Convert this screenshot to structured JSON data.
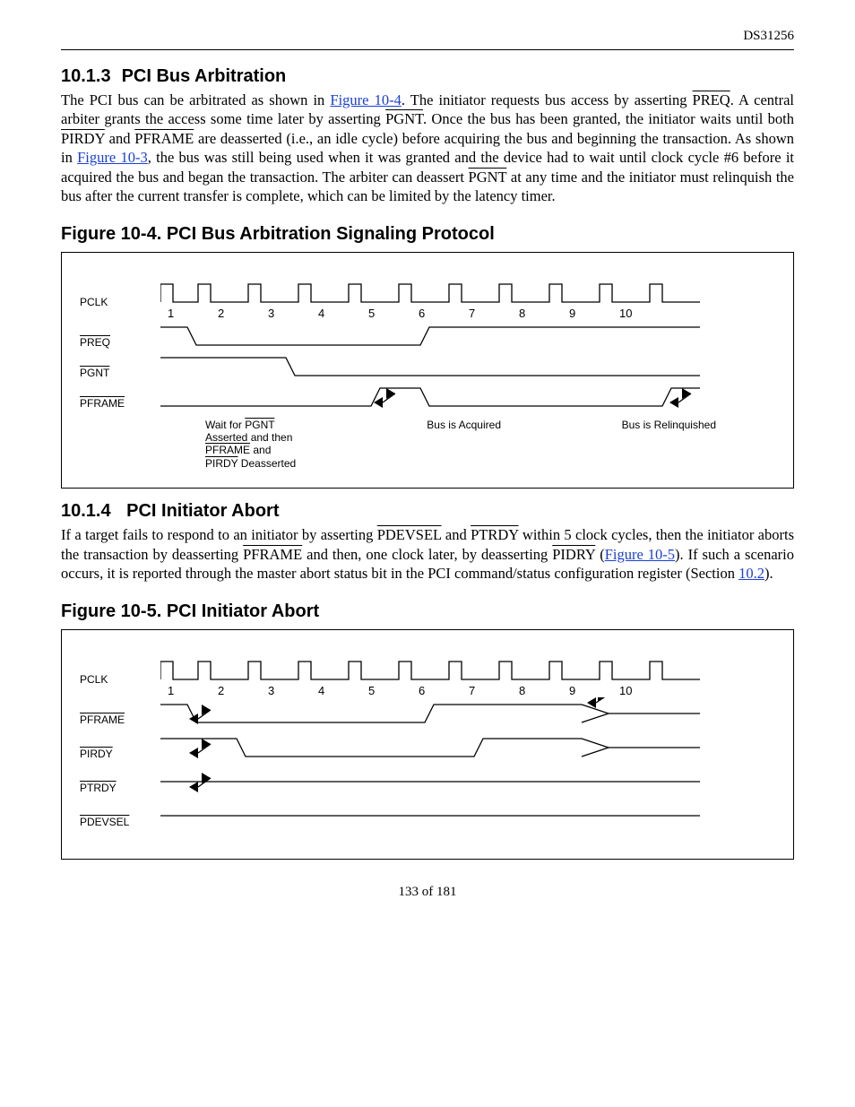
{
  "header": {
    "doc_id": "DS31256"
  },
  "section1": {
    "num": "10.1.3",
    "title": "PCI Bus Arbitration",
    "p_a": "The PCI bus can be arbitrated as shown in ",
    "link1": "Figure 10-4",
    "p_b": ". The initiator requests bus access by asserting ",
    "sig1": "PREQ",
    "p_c": ". A central arbiter grants the access some time later by asserting ",
    "sig2": "PGNT",
    "p_d": ". Once the bus has been granted, the initiator waits until both ",
    "sig3": "PIRDY",
    "p_e": " and ",
    "sig4": "PFRAME",
    "p_f": " are deasserted (i.e., an idle cycle) before acquiring the bus and beginning the transaction. As shown in ",
    "link2": "Figure 10-3",
    "p_g": ", the bus was still being used when it was granted and the device had to wait until clock cycle #6 before it acquired the bus and began the transaction. The arbiter can deassert ",
    "sig5": "PGNT",
    "p_h": " at any time and the initiator must relinquish the bus after the current transfer is complete, which can be limited by the latency timer."
  },
  "figure1": {
    "caption": "Figure 10-4. PCI Bus Arbitration Signaling Protocol",
    "ticks": [
      "1",
      "2",
      "3",
      "4",
      "5",
      "6",
      "7",
      "8",
      "9",
      "10"
    ],
    "signals": {
      "s1": "PCLK",
      "s2": "PREQ",
      "s3": "PGNT",
      "s4": "PFRAME"
    },
    "annot1_a": "Wait for ",
    "annot1_sig1": "PGNT",
    "annot1_b": " Asserted and then ",
    "annot1_sig2": "PFRAME",
    "annot1_c": " and ",
    "annot1_sig3": "PIRDY",
    "annot1_d": " Deasserted",
    "annot2": "Bus is Acquired",
    "annot3": "Bus is Relinquished"
  },
  "section2": {
    "num": "10.1.4",
    "title": "PCI Initiator Abort",
    "p_a": "If a target fails to respond to an initiator by asserting ",
    "sig1": "PDEVSEL",
    "p_b": " and ",
    "sig2": "PTRDY",
    "p_c": " within 5 clock cycles, then the initiator aborts the transaction by deasserting ",
    "sig3": "PFRAME",
    "p_d": " and then, one clock later, by deasserting ",
    "sig4": "PIDRY",
    "p_e": " (",
    "link1": "Figure 10-5",
    "p_f": "). If such a scenario occurs, it is reported through the master abort status bit in the PCI command/status configuration register (Section ",
    "link2": "10.2",
    "p_g": ")."
  },
  "figure2": {
    "caption": "Figure 10-5. PCI Initiator Abort",
    "ticks": [
      "1",
      "2",
      "3",
      "4",
      "5",
      "6",
      "7",
      "8",
      "9",
      "10"
    ],
    "signals": {
      "s1": "PCLK",
      "s2": "PFRAME",
      "s3": "PIRDY",
      "s4": "PTRDY",
      "s5": "PDEVSEL"
    }
  },
  "footer": {
    "page": "133 of 181"
  },
  "chart_data": [
    {
      "type": "timing-diagram",
      "title": "PCI Bus Arbitration Signaling Protocol",
      "clock_cycles": 10,
      "signals": [
        {
          "name": "PCLK",
          "type": "clock",
          "period_cycles": 1
        },
        {
          "name": "PREQ",
          "active_low": true,
          "transitions": [
            {
              "cycle": 1,
              "dir": "low"
            },
            {
              "cycle": 6,
              "dir": "high"
            }
          ]
        },
        {
          "name": "PGNT",
          "active_low": true,
          "transitions": [
            {
              "cycle": 3,
              "dir": "low"
            }
          ]
        },
        {
          "name": "PFRAME",
          "active_low": true,
          "initial": "low",
          "transitions": [
            {
              "cycle": 5,
              "dir": "high"
            },
            {
              "cycle": 6,
              "dir": "low"
            },
            {
              "cycle": 10,
              "dir": "high"
            }
          ]
        }
      ],
      "annotations": [
        {
          "text": "Wait for PGNT Asserted and then PFRAME and PIRDY Deasserted",
          "at_cycle": 3
        },
        {
          "text": "Bus is Acquired",
          "at_cycle": 6
        },
        {
          "text": "Bus is Relinquished",
          "at_cycle": 10
        }
      ]
    },
    {
      "type": "timing-diagram",
      "title": "PCI Initiator Abort",
      "clock_cycles": 10,
      "signals": [
        {
          "name": "PCLK",
          "type": "clock",
          "period_cycles": 1
        },
        {
          "name": "PFRAME",
          "active_low": true,
          "transitions": [
            {
              "cycle": 1,
              "dir": "low"
            },
            {
              "cycle": 6,
              "dir": "high"
            }
          ],
          "driven_after": 9
        },
        {
          "name": "PIRDY",
          "active_low": true,
          "transitions": [
            {
              "cycle": 2,
              "dir": "low"
            },
            {
              "cycle": 7,
              "dir": "high"
            }
          ],
          "driven_after": 9
        },
        {
          "name": "PTRDY",
          "active_low": true,
          "state": "tristate"
        },
        {
          "name": "PDEVSEL",
          "active_low": true,
          "state": "tristate"
        }
      ]
    }
  ]
}
